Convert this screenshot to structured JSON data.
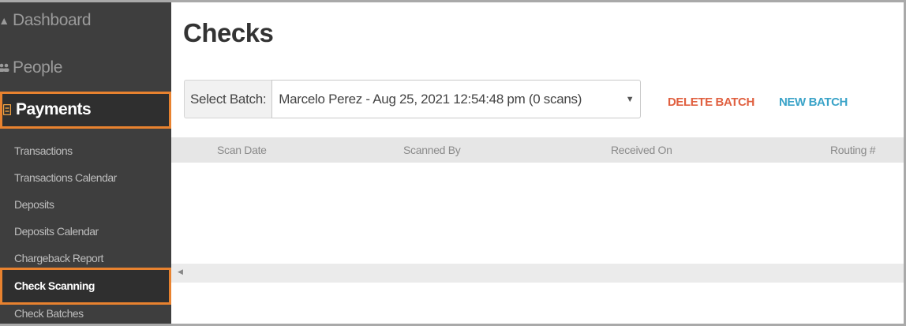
{
  "sidebar": {
    "dashboard": {
      "label": "Dashboard",
      "icon": "dashboard-icon"
    },
    "people": {
      "label": "People",
      "icon": "people-icon"
    },
    "payments": {
      "label": "Payments",
      "icon": "payments-icon"
    },
    "sub_items": [
      "Transactions",
      "Transactions Calendar",
      "Deposits",
      "Deposits Calendar",
      "Chargeback Report",
      "Check Scanning",
      "Check Batches"
    ],
    "active_sub_item": "Check Scanning"
  },
  "main": {
    "title": "Checks",
    "batch": {
      "label": "Select Batch:",
      "selected": "Marcelo Perez - Aug 25, 2021 12:54:48 pm (0 scans)"
    },
    "actions": {
      "delete": "DELETE BATCH",
      "new": "NEW BATCH"
    },
    "table": {
      "columns": [
        "Scan Date",
        "Scanned By",
        "Received On",
        "Routing #"
      ],
      "rows": []
    }
  },
  "colors": {
    "sidebar_bg": "#3e3e3e",
    "highlight": "#e8822f",
    "delete": "#e06040",
    "new": "#3aa3c8"
  }
}
